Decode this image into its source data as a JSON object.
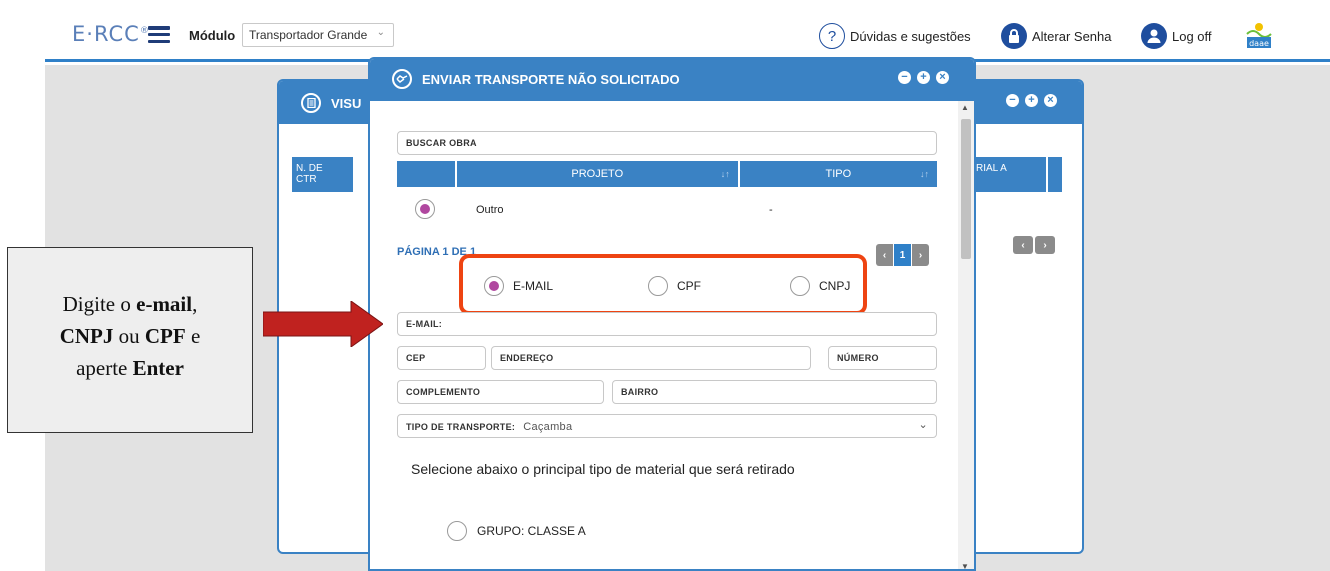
{
  "header": {
    "logo_text": "E·RCC",
    "modulo_label": "Módulo",
    "modulo_value": "Transportador Grande",
    "duvidas": "Dúvidas e sugestões",
    "alterar_senha": "Alterar Senha",
    "logoff": "Log off",
    "brand_logo": "daae"
  },
  "background_panel": {
    "title": "VISU",
    "col1": "N. DE\nCTR",
    "col2": "RIAL A"
  },
  "modal": {
    "title": "ENVIAR TRANSPORTE NÃO SOLICITADO",
    "buscar_obra": "BUSCAR OBRA",
    "table": {
      "headers": [
        "PROJETO",
        "TIPO"
      ],
      "rows": [
        {
          "projeto": "Outro",
          "tipo": "-",
          "selected": true
        }
      ]
    },
    "pagination": {
      "text": "PÁGINA 1 DE 1",
      "current": "1",
      "prev": "‹",
      "next": "›"
    },
    "id_options": [
      {
        "label": "E-MAIL",
        "selected": true
      },
      {
        "label": "CPF",
        "selected": false
      },
      {
        "label": "CNPJ",
        "selected": false
      }
    ],
    "fields": {
      "email": "E-MAIL:",
      "cep": "CEP",
      "endereco": "ENDEREÇO",
      "numero": "NÚMERO",
      "complemento": "COMPLEMENTO",
      "bairro": "BAIRRO",
      "tipo_transporte_label": "TIPO DE TRANSPORTE:",
      "tipo_transporte_value": "Caçamba"
    },
    "material_prompt": "Selecione abaixo o principal tipo de material que será retirado",
    "grupo_label": "GRUPO: CLASSE A"
  },
  "callout": {
    "t1": "Digite o ",
    "b1": "e-mail",
    "t2": ",",
    "b2": "CNPJ",
    "t3": " ou ",
    "b3": "CPF",
    "t4": " e",
    "t5": "aperte ",
    "b4": "Enter"
  },
  "colors": {
    "primary": "#3a82c4",
    "highlight": "#ee4412",
    "radio_selected": "#b0479f",
    "arrow": "#c0221f"
  }
}
